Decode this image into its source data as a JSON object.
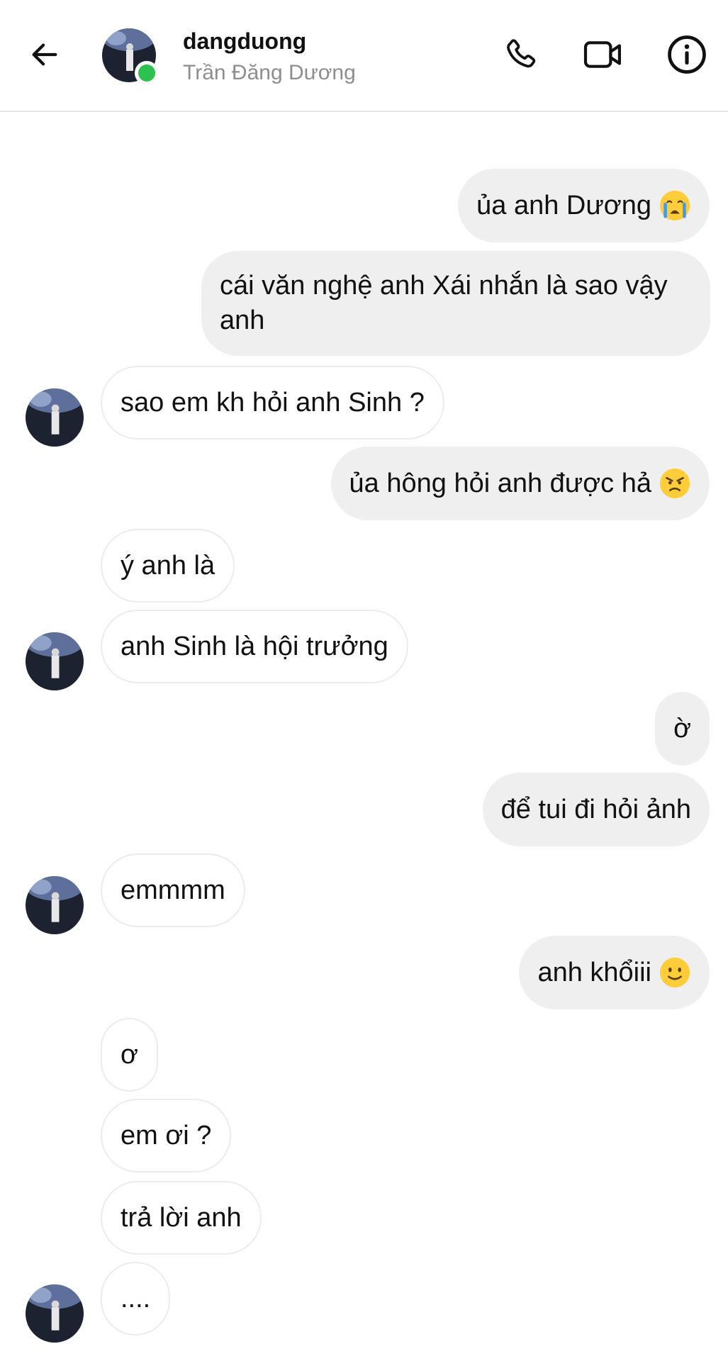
{
  "header": {
    "username": "dangduong",
    "fullname": "Trần Đăng Dương"
  },
  "messages": [
    {
      "dir": "out",
      "text": "ủa anh Dương",
      "emoji": "crying-face-icon"
    },
    {
      "dir": "out",
      "text": "cái văn nghệ anh Xái nhắn là sao vậy anh"
    },
    {
      "dir": "in",
      "text": "sao em kh hỏi anh Sinh ?"
    },
    {
      "dir": "out",
      "text": "ủa hông hỏi anh được hả",
      "emoji": "angry-face-icon"
    },
    {
      "dir": "in",
      "text": "ý anh là"
    },
    {
      "dir": "in",
      "text": "anh Sinh là hội trưởng"
    },
    {
      "dir": "out",
      "text": "ờ"
    },
    {
      "dir": "out",
      "text": "để tui đi hỏi ảnh"
    },
    {
      "dir": "in",
      "text": "emmmm"
    },
    {
      "dir": "out",
      "text": "anh khổiii",
      "emoji": "slight-smile-icon"
    },
    {
      "dir": "in",
      "text": "ơ"
    },
    {
      "dir": "in",
      "text": "em ơi ?"
    },
    {
      "dir": "in",
      "text": "trả lời anh"
    },
    {
      "dir": "in",
      "text": "...."
    }
  ],
  "colors": {
    "outgoing_bubble": "#efefef",
    "incoming_border": "#ececec",
    "online": "#2dc24f",
    "secondary_text": "#8e8e8e"
  }
}
